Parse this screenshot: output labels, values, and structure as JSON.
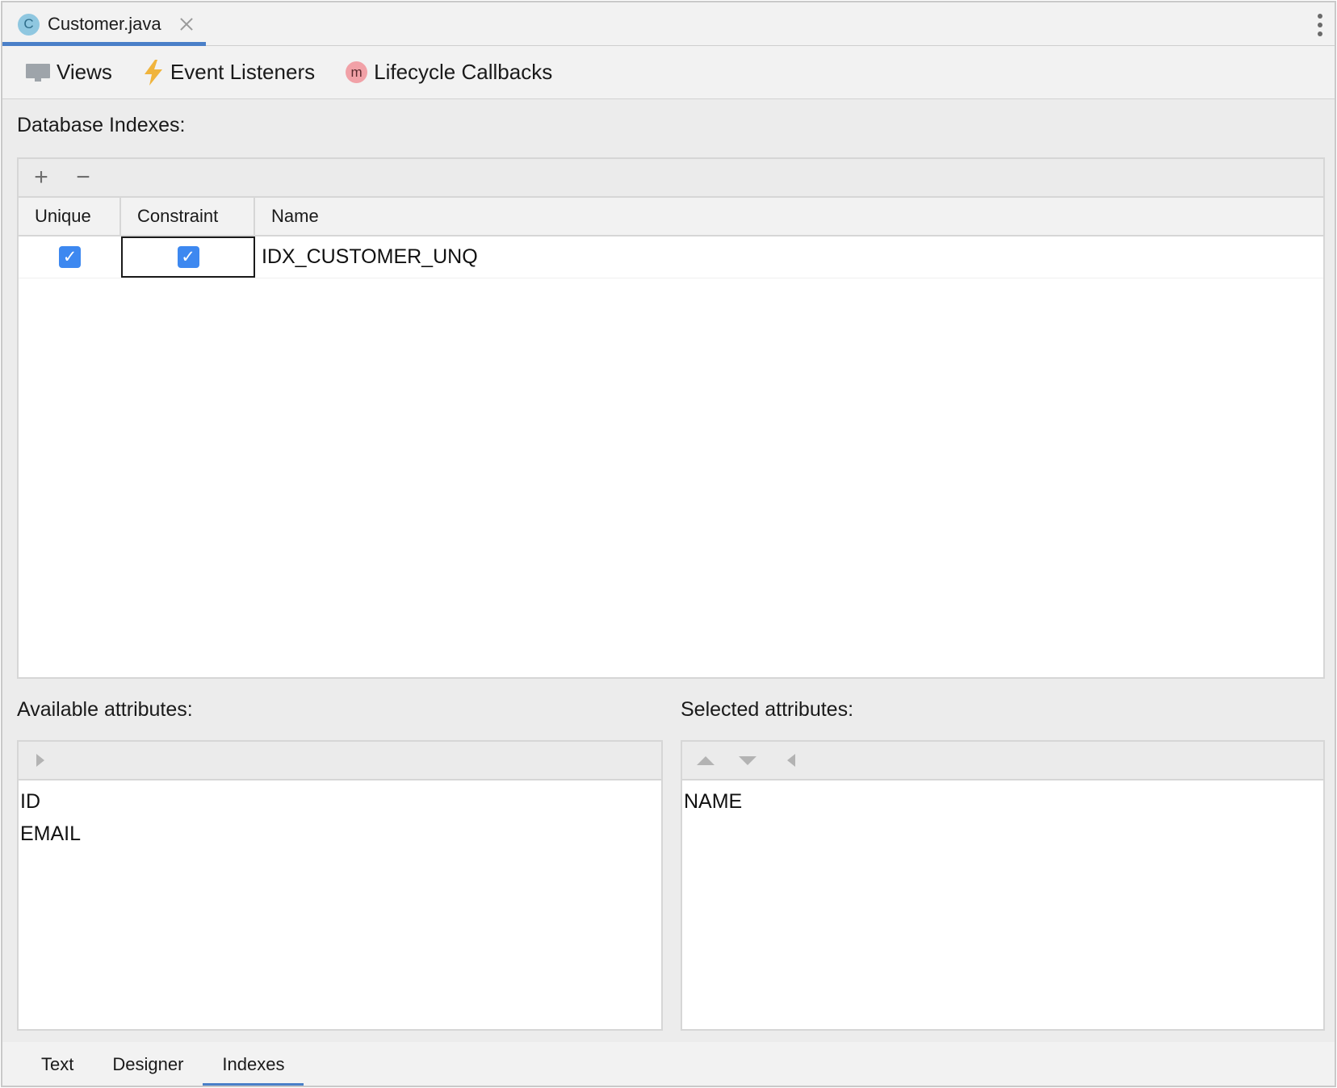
{
  "editor_tab": {
    "icon_letter": "C",
    "file_name": "Customer.java"
  },
  "toolbar": {
    "items": [
      {
        "label": "Views",
        "icon": "monitor-icon"
      },
      {
        "label": "Event Listeners",
        "icon": "lightning-icon"
      },
      {
        "label": "Lifecycle Callbacks",
        "icon": "method-icon",
        "icon_letter": "m"
      }
    ]
  },
  "indexes": {
    "title": "Database Indexes:",
    "add_symbol": "+",
    "remove_symbol": "−",
    "columns": [
      "Unique",
      "Constraint",
      "Name"
    ],
    "rows": [
      {
        "unique": true,
        "constraint": true,
        "name": "IDX_CUSTOMER_UNQ"
      }
    ]
  },
  "available_attributes": {
    "title": "Available attributes:",
    "items": [
      "ID",
      "EMAIL"
    ]
  },
  "selected_attributes": {
    "title": "Selected attributes:",
    "items": [
      "NAME"
    ]
  },
  "bottom_tabs": {
    "items": [
      "Text",
      "Designer",
      "Indexes"
    ],
    "active": "Indexes"
  },
  "colors": {
    "accent": "#4a7fc8",
    "checkbox": "#3d88f0",
    "class_icon": "#8fc7e0",
    "method_icon": "#f1a1a7",
    "lightning": "#f0b43c"
  }
}
